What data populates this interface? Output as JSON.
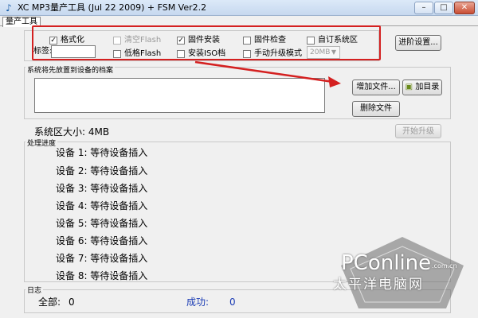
{
  "window": {
    "title": "XC MP3量产工具 (Jul 22 2009) + FSM Ver2.2",
    "min_glyph": "–",
    "max_glyph": "□",
    "close_glyph": "✕"
  },
  "tabs": [
    {
      "label": "量产工具",
      "active": true
    }
  ],
  "options": {
    "format": {
      "label": "格式化",
      "checked": true
    },
    "clear_flash": {
      "label": "清空Flash",
      "checked": false,
      "disabled": true
    },
    "firmware_install": {
      "label": "固件安装",
      "checked": true
    },
    "firmware_check": {
      "label": "固件检查",
      "checked": false
    },
    "custom_system_area": {
      "label": "自订系统区",
      "checked": false
    },
    "low_format_flash": {
      "label": "低格Flash",
      "checked": false
    },
    "install_iso": {
      "label": "安装ISO档",
      "checked": false
    },
    "manual_upgrade": {
      "label": "手动升级模式",
      "checked": false
    },
    "tag_label": "标签:",
    "tag_value": "",
    "size_select": "20MB",
    "check_glyph": "✓"
  },
  "buttons": {
    "advanced": "进阶设置...",
    "add_file": "增加文件...",
    "add_dir": "加目录",
    "del_file": "删除文件",
    "start_upgrade": "开始升级"
  },
  "file_group": {
    "title": "系统将先放置到设备的档案"
  },
  "system_area": "系统区大小: 4MB",
  "progress": {
    "title": "处理进度",
    "devices": [
      "设备 1: 等待设备插入",
      "设备 2: 等待设备插入",
      "设备 3: 等待设备插入",
      "设备 4: 等待设备插入",
      "设备 5: 等待设备插入",
      "设备 6: 等待设备插入",
      "设备 7: 等待设备插入",
      "设备 8: 等待设备插入"
    ]
  },
  "log": {
    "title": "日志",
    "total_label": "全部:",
    "total_value": "0",
    "success_label": "成功:",
    "success_value": "0"
  },
  "watermark": {
    "logo": "PConline",
    "domain": ".com.cn",
    "cn": "太平洋电脑网"
  },
  "colors": {
    "annotation": "#d42020",
    "success_text": "#1a3bb4"
  }
}
